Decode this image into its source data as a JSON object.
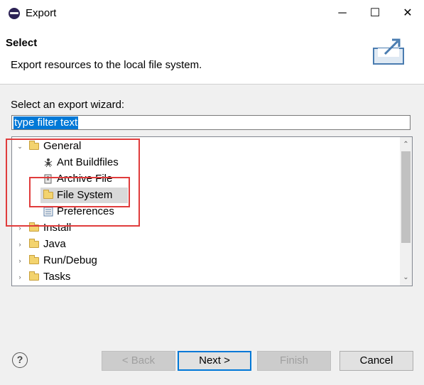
{
  "window": {
    "title": "Export",
    "minimize_glyph": "─",
    "maximize_glyph": "☐",
    "close_glyph": "✕"
  },
  "header": {
    "title": "Select",
    "description": "Export resources to the local file system.",
    "icon": "export-wizard-icon"
  },
  "wizard": {
    "label": "Select an export wizard:",
    "filter_text": "type filter text"
  },
  "tree": {
    "items": [
      {
        "label": "General",
        "expanded": true,
        "icon": "folder-icon",
        "depth": 0
      },
      {
        "label": "Ant Buildfiles",
        "icon": "ant-icon",
        "depth": 1
      },
      {
        "label": "Archive File",
        "icon": "archive-icon",
        "depth": 1
      },
      {
        "label": "File System",
        "icon": "folder-icon",
        "depth": 1,
        "selected": true
      },
      {
        "label": "Preferences",
        "icon": "preferences-icon",
        "depth": 1
      },
      {
        "label": "Install",
        "expanded": false,
        "icon": "folder-icon",
        "depth": 0
      },
      {
        "label": "Java",
        "expanded": false,
        "icon": "folder-icon",
        "depth": 0
      },
      {
        "label": "Run/Debug",
        "expanded": false,
        "icon": "folder-icon",
        "depth": 0
      },
      {
        "label": "Tasks",
        "expanded": false,
        "icon": "folder-icon",
        "depth": 0
      }
    ]
  },
  "buttons": {
    "help": "?",
    "back": "< Back",
    "next": "Next >",
    "finish": "Finish",
    "cancel": "Cancel"
  },
  "colors": {
    "highlight_box": "#e03c3c",
    "selection": "#0078d7",
    "selected_row": "#d9d9d9"
  }
}
